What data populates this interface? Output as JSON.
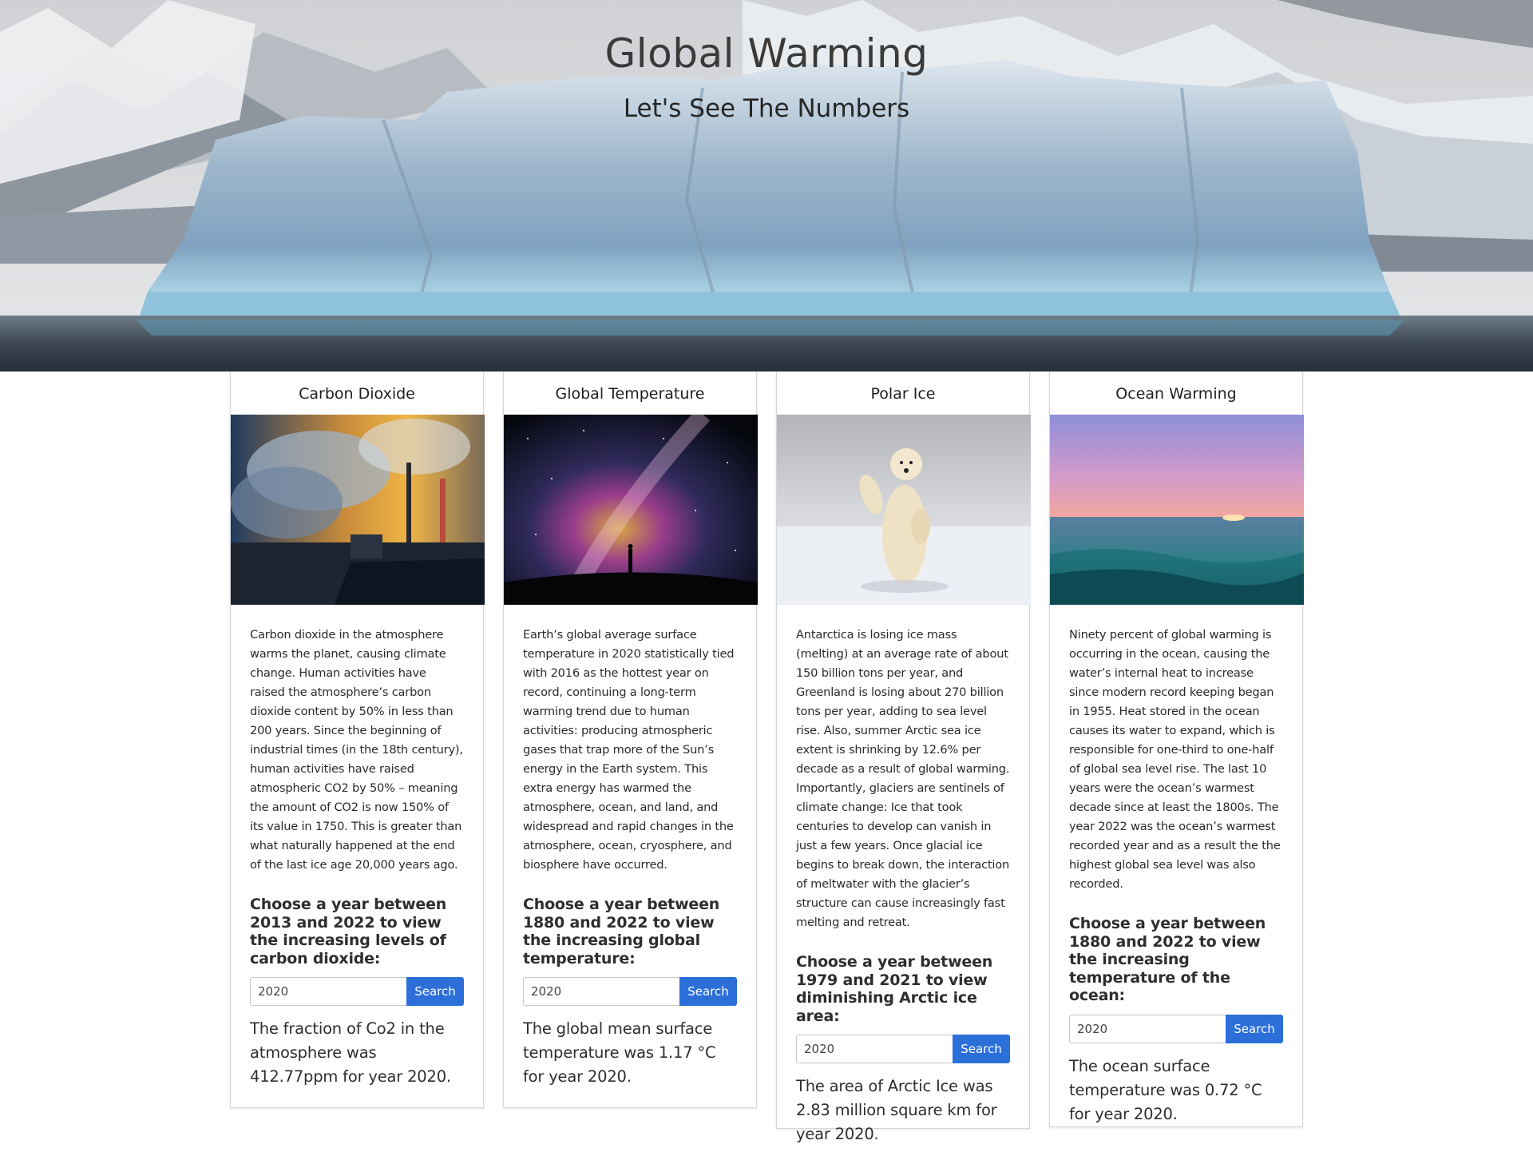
{
  "hero": {
    "title": "Global Warming",
    "subtitle": "Let's See The Numbers"
  },
  "cards": [
    {
      "title": "Carbon Dioxide",
      "image": "factory-smokestacks-image",
      "text": "Carbon dioxide in the atmosphere warms the planet, causing climate change. Human activities have raised the atmosphere’s carbon dioxide content by 50% in less than 200 years. Since the beginning of industrial times (in the 18th century), human activities have raised atmospheric CO2 by 50% – meaning the amount of CO2 is now 150% of its value in 1750. This is greater than what naturally happened at the end of the last ice age 20,000 years ago.",
      "prompt": "Choose a year between 2013 and 2022 to view the increasing levels of carbon dioxide:",
      "input_value": "2020",
      "button_label": "Search",
      "result": "The fraction of Co2 in the atmosphere was 412.77ppm for year 2020."
    },
    {
      "title": "Global Temperature",
      "image": "milky-way-night-sky-image",
      "text": "Earth’s global average surface temperature in 2020 statistically tied with 2016 as the hottest year on record, continuing a long-term warming trend due to human activities: producing atmospheric gases that trap more of the Sun’s energy in the Earth system. This extra energy has warmed the atmosphere, ocean, and land, and widespread and rapid changes in the atmosphere, ocean, cryosphere, and biosphere have occurred.",
      "prompt": "Choose a year between 1880 and 2022 to view the increasing global temperature:",
      "input_value": "2020",
      "button_label": "Search",
      "result": "The global mean surface temperature was 1.17 °C for year 2020."
    },
    {
      "title": "Polar Ice",
      "image": "polar-bear-on-ice-image",
      "text": "Antarctica is losing ice mass (melting) at an average rate of about 150 billion tons per year, and Greenland is losing about 270 billion tons per year, adding to sea level rise. Also, summer Arctic sea ice extent is shrinking by 12.6% per decade as a result of global warming. Importantly, glaciers are sentinels of climate change: Ice that took centuries to develop can vanish in just a few years. Once glacial ice begins to break down, the interaction of meltwater with the glacier’s structure can cause increasingly fast melting and retreat.",
      "prompt": "Choose a year between 1979 and 2021 to view diminishing Arctic ice area:",
      "input_value": "2020",
      "button_label": "Search",
      "result": "The area of Arctic Ice was 2.83 million square km for year 2020."
    },
    {
      "title": "Ocean Warming",
      "image": "ocean-sunset-image",
      "text": "Ninety percent of global warming is occurring in the ocean, causing the water’s internal heat to increase since modern record keeping began in 1955. Heat stored in the ocean causes its water to expand, which is responsible for one-third to one-half of global sea level rise. The last 10 years were the ocean’s warmest decade since at least the 1800s. The year 2022 was the ocean’s warmest recorded year and as a result the the highest global sea level was also recorded.",
      "prompt": "Choose a year between 1880 and 2022 to view the increasing temperature of the ocean:",
      "input_value": "2020",
      "button_label": "Search",
      "result": "The ocean surface temperature was 0.72 °C for year 2020."
    }
  ]
}
